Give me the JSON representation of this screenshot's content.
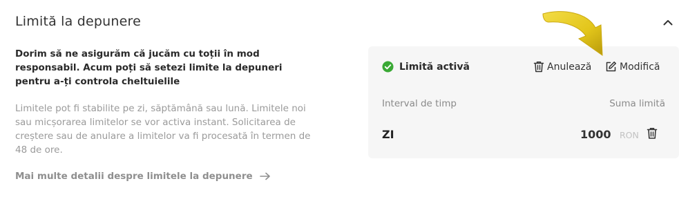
{
  "section": {
    "title": "Limită la depunere"
  },
  "intro": {
    "text": "Dorim să ne asigurăm că jucăm cu toții în mod responsabil. Acum poți să setezi limite la depuneri pentru a-ți controla cheltuielile"
  },
  "description": {
    "text": "Limitele pot fi stabilite pe zi, săptămână sau lună. Limitele noi sau micșorarea limitelor se vor activa instant. Solicitarea de creștere sau de anulare a limitelor va fi procesată în termen de 48 de ore."
  },
  "more_link": {
    "label": "Mai multe detalii despre limitele la depunere"
  },
  "card": {
    "status_label": "Limită activă",
    "cancel_label": "Anulează",
    "edit_label": "Modifică",
    "columns": {
      "interval": "Interval de timp",
      "amount": "Suma limită"
    },
    "row": {
      "period": "ZI",
      "amount": "1000",
      "currency": "RON"
    }
  },
  "icons": {
    "collapse": "chevron-up-icon",
    "status": "check-circle-icon",
    "cancel": "trash-icon",
    "edit": "edit-icon",
    "link_arrow": "arrow-right-icon",
    "row_delete": "trash-icon"
  },
  "colors": {
    "status_green": "#3aa935",
    "card_background": "#f6f6f6",
    "annotation_arrow": "#e2c51a"
  }
}
